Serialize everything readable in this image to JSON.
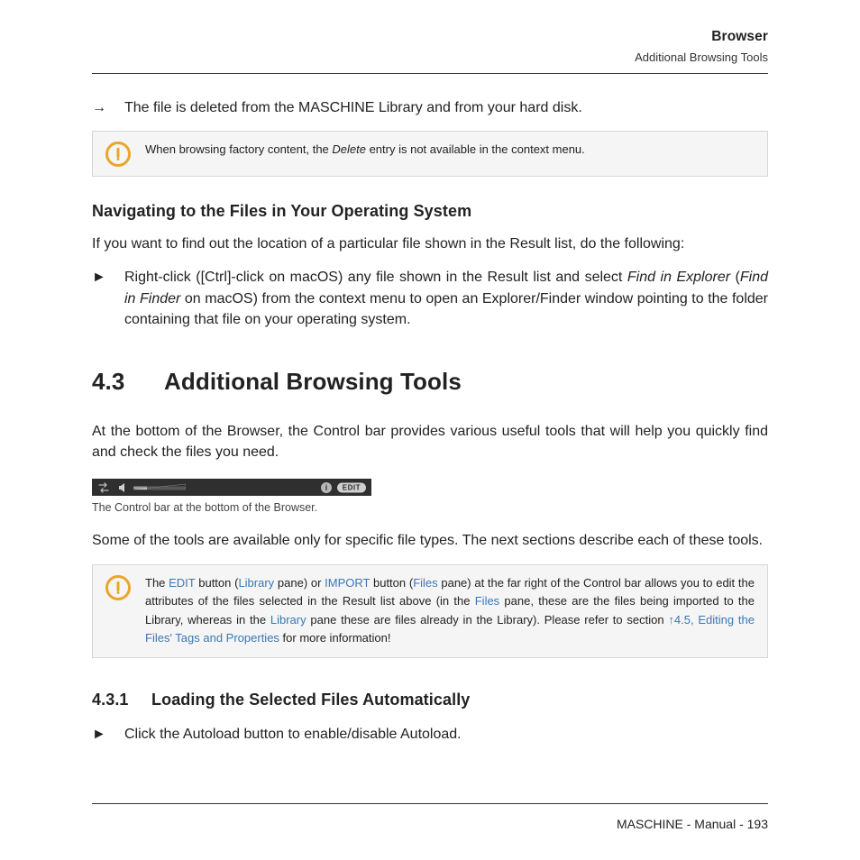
{
  "header": {
    "title": "Browser",
    "subtitle": "Additional Browsing Tools"
  },
  "result_arrow": "→",
  "result_text": "The file is deleted from the MASCHINE Library and from your hard disk.",
  "callout1": {
    "pre": "When browsing factory content, the ",
    "em": "Delete",
    "post": " entry is not available in the context menu."
  },
  "h_nav": "Navigating to the Files in Your Operating System",
  "nav_intro": "If you want to find out the location of a particular file shown in the Result list, do the following:",
  "step_marker": "►",
  "nav_step": {
    "t1": "Right-click ([Ctrl]-click on macOS) any file shown in the Result list and select ",
    "em1": "Find in Explorer",
    "t2": " (",
    "em2": "Find in Finder",
    "t3": " on macOS) from the context menu to open an Explorer/Finder window pointing to the folder containing that file on your operating system."
  },
  "sec43": {
    "num": "4.3",
    "title": "Additional Browsing Tools"
  },
  "sec43_p1": "At the bottom of the Browser, the Control bar provides various useful tools that will help you quickly find and check the files you need.",
  "ctrlbar": {
    "info": "i",
    "edit": "EDIT",
    "caption": "The Control bar at the bottom of the Browser."
  },
  "sec43_p2": "Some of the tools are available only for specific file types. The next sections describe each of these tools.",
  "callout2": {
    "t1": "The ",
    "link1": "EDIT",
    "t2": " button (",
    "link2": "Library",
    "t3": " pane) or ",
    "link3": "IMPORT",
    "t4": " button (",
    "link4": "Files",
    "t5": " pane) at the far right of the Control bar allows you to edit the attributes of the files selected in the Result list above (in the ",
    "link5": "Files",
    "t6": " pane, these are the files being imported to the Library, whereas in the ",
    "link6": "Library",
    "t7": " pane these are files already in the Library). Please refer to section ",
    "arrow": "↑",
    "linkref": "4.5, Editing the Files' Tags and Properties",
    "t8": " for more information!"
  },
  "sec431": {
    "num": "4.3.1",
    "title": "Loading the Selected Files Automatically"
  },
  "sec431_step": "Click the Autoload button to enable/disable Autoload.",
  "footer": "MASCHINE - Manual - 193"
}
